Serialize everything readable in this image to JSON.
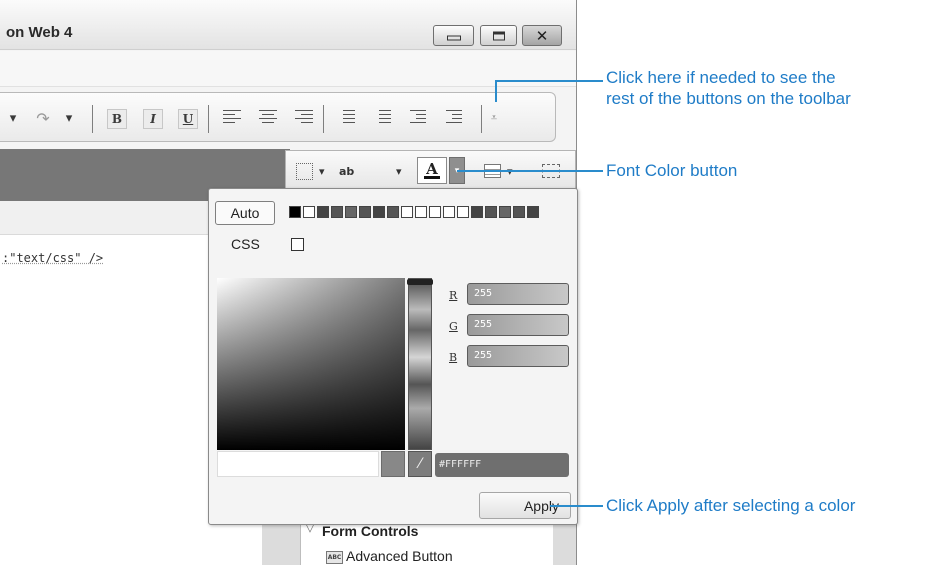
{
  "window": {
    "title": "on Web 4",
    "controls": {
      "minimize_icon": "minimize-icon",
      "maximize_icon": "maximize-icon",
      "close_glyph": "✕"
    }
  },
  "main_toolbar": {
    "redo_glyph": "↷",
    "dropdown_glyph": "▾",
    "bold_label": "B",
    "italic_label": "I",
    "underline_label": "U",
    "overflow_glyph": "⩡"
  },
  "editor": {
    "code_fragment": ":\"text/css\" />"
  },
  "format_toolbar": {
    "highlight_label": "ab",
    "font_color_letter": "A",
    "dropdown_glyph": "▾"
  },
  "color_picker": {
    "auto_label": "Auto",
    "css_label": "CSS",
    "css_checked": false,
    "swatches": [
      "#000000",
      "#ffffff",
      "#444444",
      "#555555",
      "#666666",
      "#555555",
      "#444444",
      "#555555",
      "#ffffff",
      "#ffffff",
      "#ffffff",
      "#ffffff",
      "#ffffff",
      "#444444",
      "#555555",
      "#666666",
      "#555555",
      "#444444"
    ],
    "r_label": "R",
    "g_label": "G",
    "b_label": "B",
    "r_value": "255",
    "g_value": "255",
    "b_value": "255",
    "hex_value": "#FFFFFF",
    "eyedropper_glyph": "⁄",
    "apply_label": "Apply"
  },
  "side_panel": {
    "section_title": "Form Controls",
    "section_chevron": "▽",
    "item_icon_label": "ABC",
    "item_label": "Advanced Button"
  },
  "callouts": {
    "toolbar_overflow": [
      "Click here if needed to see the",
      "rest of the buttons on the toolbar"
    ],
    "font_color": "Font Color button",
    "apply": "Click Apply after selecting a color"
  },
  "colors": {
    "callout": "#1f7cc7"
  }
}
